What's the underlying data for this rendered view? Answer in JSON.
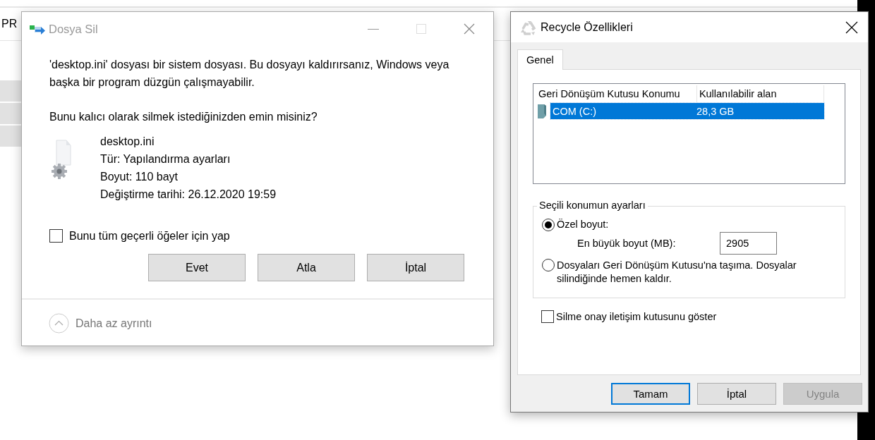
{
  "background": {
    "label": "PR"
  },
  "delete_dialog": {
    "title": "Dosya Sil",
    "message": "'desktop.ini' dosyası bir sistem dosyası. Bu dosyayı kaldırırsanız, Windows veya başka bir program düzgün çalışmayabilir.",
    "question": "Bunu kalıcı olarak silmek istediğinizden emin misiniz?",
    "file": {
      "name": "desktop.ini",
      "type": "Tür: Yapılandırma ayarları",
      "size": "Boyut: 110 bayt",
      "modified": "Değiştirme tarihi: 26.12.2020 19:59"
    },
    "apply_all": {
      "label": "Bunu tüm geçerli öğeler için yap",
      "checked": false
    },
    "buttons": [
      {
        "label": "Evet"
      },
      {
        "label": "Atla"
      },
      {
        "label": "İptal"
      }
    ],
    "details_toggle": "Daha az ayrıntı"
  },
  "properties_dialog": {
    "title": "Recycle Özellikleri",
    "tabs": [
      {
        "label": "Genel",
        "selected": true
      }
    ],
    "table": {
      "columns": [
        "Geri Dönüşüm Kutusu Konumu",
        "Kullanılabilir alan"
      ],
      "rows": [
        {
          "location": "COM (C:)",
          "free_space": "28,3 GB",
          "selected": true
        }
      ]
    },
    "settings": {
      "title": "Seçili konumun ayarları",
      "options": [
        {
          "label": "Özel boyut:",
          "selected": true
        },
        {
          "label": "Dosyaları Geri Dönüşüm Kutusu'na taşıma. Dosyalar silindiğinde hemen kaldır.",
          "selected": false
        }
      ],
      "max_size": {
        "label": "En büyük boyut (MB):",
        "value": "2905"
      }
    },
    "confirm": {
      "label": "Silme onay iletişim kutusunu göster",
      "checked": false
    },
    "buttons": [
      {
        "label": "Tamam",
        "default": true,
        "disabled": false
      },
      {
        "label": "İptal",
        "default": false,
        "disabled": false
      },
      {
        "label": "Uygula",
        "default": false,
        "disabled": true
      }
    ]
  }
}
